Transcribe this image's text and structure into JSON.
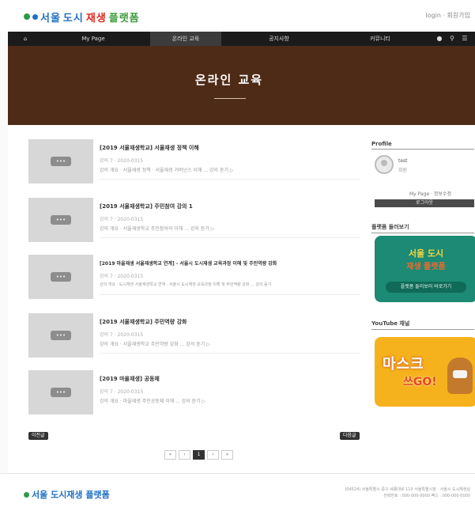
{
  "header": {
    "logo_part1": "서울",
    "logo_part2": "도시",
    "logo_part3": "재생",
    "logo_part4": "플랫폼",
    "top_links": "login · 회원가입"
  },
  "nav": {
    "home_icon": "home-icon",
    "items": [
      "My Page",
      "온라인 교육",
      "공지사항",
      "커뮤니티"
    ],
    "icons": [
      "lock-icon",
      "search-icon",
      "menu-icon"
    ]
  },
  "banner": {
    "title": "온라인 교육"
  },
  "courses": [
    {
      "title": "[2019 서울재생학교] 서울재생 정책 이해",
      "meta": "강의 7 · 2020-0315",
      "desc": "강의 개요 · 서울재생 정책 · 서울재생 거버넌스 이해 ... 강의 듣기 ▷",
      "thumb": "•••"
    },
    {
      "title": "[2019 서울재생학교] 주민참여 강의 1",
      "meta": "강의 7 · 2020-0315",
      "desc": "강의 개요 · 서울재생학교 주민참여의 이해 ... 강의 듣기 ▷",
      "thumb": "•••"
    },
    {
      "title": "[2019 마을재생 서울재생학교 연계] - 서울시 도시재생 교육과정 이해 및 주민역량 강화",
      "meta": "강의 7 · 2020-0315",
      "desc": "강의 개요 · 도시재생 서울재생학교 연계 · 서울시 도시재생 교육과정 이해 및 주민역량 강화 ... 강의 듣기",
      "thumb": "•••"
    },
    {
      "title": "[2019 서울재생학교] 주민역량 강화",
      "meta": "강의 7 · 2020-0315",
      "desc": "강의 개요 · 서울재생학교 주민역량 강화 ... 강의 듣기 ▷",
      "thumb": "•••"
    },
    {
      "title": "[2019 마을재생] 공동체",
      "meta": "강의 7 · 2020-0315",
      "desc": "강의 개요 · 마을재생 주민공동체 이해 ... 강의 듣기 ▷",
      "thumb": "•••"
    }
  ],
  "list_buttons": {
    "prev": "이전글",
    "next": "다음글"
  },
  "pagination": {
    "prev": "‹",
    "current": "1",
    "next": "›",
    "first": "«",
    "last": "»"
  },
  "sidebar": {
    "profile_title": "Profile",
    "user_name": "test",
    "user_role": "회원",
    "links": "My Page · 정보수정",
    "logout": "로그아웃",
    "promo1_title": "플랫폼 둘러보기",
    "promo1_line1": "서울 도시",
    "promo1_line2": "재생 플랫폼",
    "promo1_button": "플랫폼 둘러보러 바로가기",
    "promo2_title": "YouTube 채널",
    "promo2_line1": "마스크",
    "promo2_line2": "쓰GO!"
  },
  "footer": {
    "logo": "서울 도시재생 플랫폼",
    "info_line1": "(04524) 서울특별시 중구 세종대로 110 서울특별시청 · 서울시 도시재생실",
    "info_line2": "전화번호 : 000-000-0000 팩스 : 000-000-0000"
  }
}
